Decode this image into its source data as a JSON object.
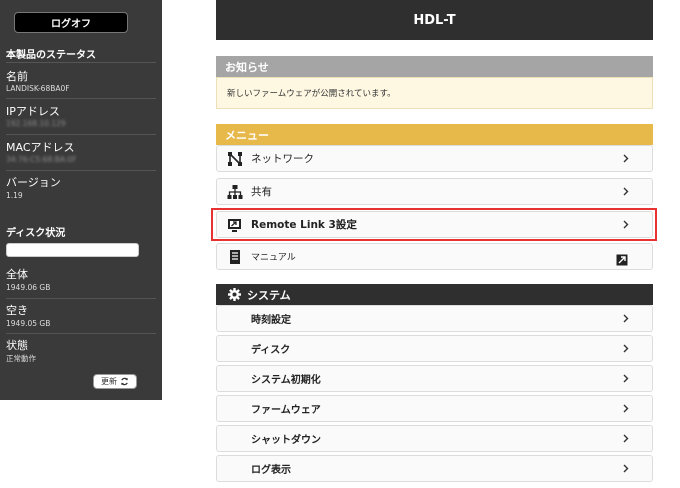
{
  "sidebar": {
    "logoff_label": "ログオフ",
    "status_title": "本製品のステータス",
    "name_label": "名前",
    "name_value": "LANDISK-68BA0F",
    "ip_label": "IPアドレス",
    "ip_value": "192.168.10.129",
    "mac_label": "MACアドレス",
    "mac_value": "34:76:C5:68:BA:0F",
    "version_label": "バージョン",
    "version_value": "1.19",
    "disk_title": "ディスク状況",
    "total_label": "全体",
    "total_value": "1949.06 GB",
    "free_label": "空き",
    "free_value": "1949.05 GB",
    "state_label": "状態",
    "state_value": "正常動作",
    "refresh_label": "更新"
  },
  "header": {
    "title": "HDL-T"
  },
  "notice": {
    "title": "お知らせ",
    "message": "新しいファームウェアが公開されています。"
  },
  "menu": {
    "title": "メニュー",
    "items": [
      {
        "label": "ネットワーク",
        "icon": "network-icon"
      },
      {
        "label": "共有",
        "icon": "sitemap-icon"
      },
      {
        "label": "Remote Link 3設定",
        "icon": "remote-link-icon"
      },
      {
        "label": "マニュアル",
        "icon": "manual-icon"
      }
    ]
  },
  "system": {
    "title": "システム",
    "items": [
      {
        "label": "時刻設定"
      },
      {
        "label": "ディスク"
      },
      {
        "label": "システム初期化"
      },
      {
        "label": "ファームウェア"
      },
      {
        "label": "シャットダウン"
      },
      {
        "label": "ログ表示"
      }
    ]
  },
  "colors": {
    "sidebar_bg": "#3a3a3a",
    "header_bg": "#2f2f2f",
    "menu_accent": "#e7b84a",
    "notice_bg": "#fef8e3",
    "highlight": "#e63232"
  }
}
